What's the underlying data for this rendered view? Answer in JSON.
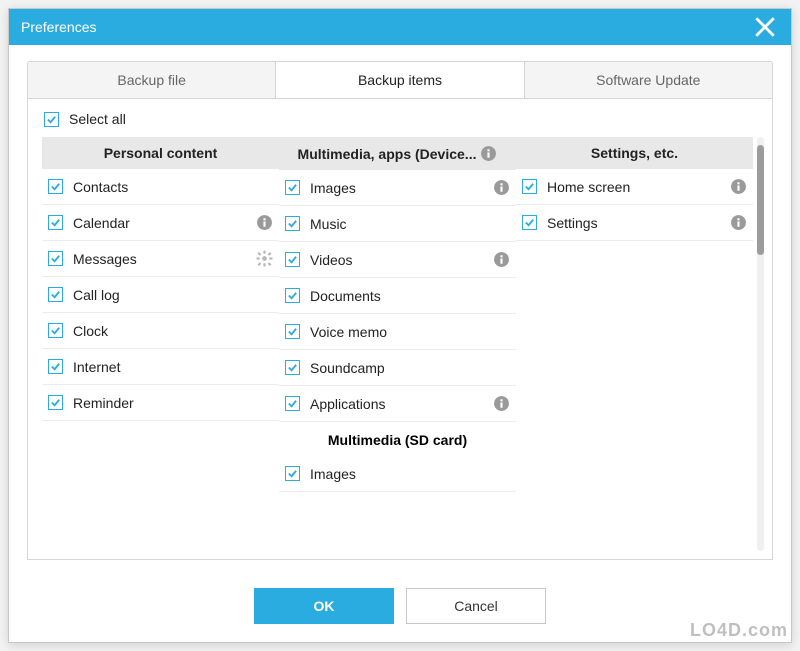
{
  "window": {
    "title": "Preferences"
  },
  "tabs": [
    {
      "label": "Backup file",
      "active": false
    },
    {
      "label": "Backup items",
      "active": true
    },
    {
      "label": "Software Update",
      "active": false
    }
  ],
  "select_all_label": "Select all",
  "columns": {
    "personal": {
      "header": "Personal content",
      "items": [
        {
          "label": "Contacts",
          "checked": true,
          "info": false,
          "gear": false
        },
        {
          "label": "Calendar",
          "checked": true,
          "info": true,
          "gear": false
        },
        {
          "label": "Messages",
          "checked": true,
          "info": false,
          "gear": true
        },
        {
          "label": "Call log",
          "checked": true,
          "info": false,
          "gear": false
        },
        {
          "label": "Clock",
          "checked": true,
          "info": false,
          "gear": false
        },
        {
          "label": "Internet",
          "checked": true,
          "info": false,
          "gear": false
        },
        {
          "label": "Reminder",
          "checked": true,
          "info": false,
          "gear": false
        }
      ]
    },
    "multimedia": {
      "header": "Multimedia, apps (Device...",
      "header_info": true,
      "items": [
        {
          "label": "Images",
          "checked": true,
          "info": true
        },
        {
          "label": "Music",
          "checked": true,
          "info": false
        },
        {
          "label": "Videos",
          "checked": true,
          "info": true
        },
        {
          "label": "Documents",
          "checked": true,
          "info": false
        },
        {
          "label": "Voice memo",
          "checked": true,
          "info": false
        },
        {
          "label": "Soundcamp",
          "checked": true,
          "info": false
        },
        {
          "label": "Applications",
          "checked": true,
          "info": true
        }
      ],
      "subheader": "Multimedia (SD card)",
      "sd_items": [
        {
          "label": "Images",
          "checked": true,
          "info": false
        }
      ]
    },
    "settings": {
      "header": "Settings, etc.",
      "items": [
        {
          "label": "Home screen",
          "checked": true,
          "info": true
        },
        {
          "label": "Settings",
          "checked": true,
          "info": true
        }
      ]
    }
  },
  "buttons": {
    "ok": "OK",
    "cancel": "Cancel"
  },
  "watermark": "LO4D.com"
}
